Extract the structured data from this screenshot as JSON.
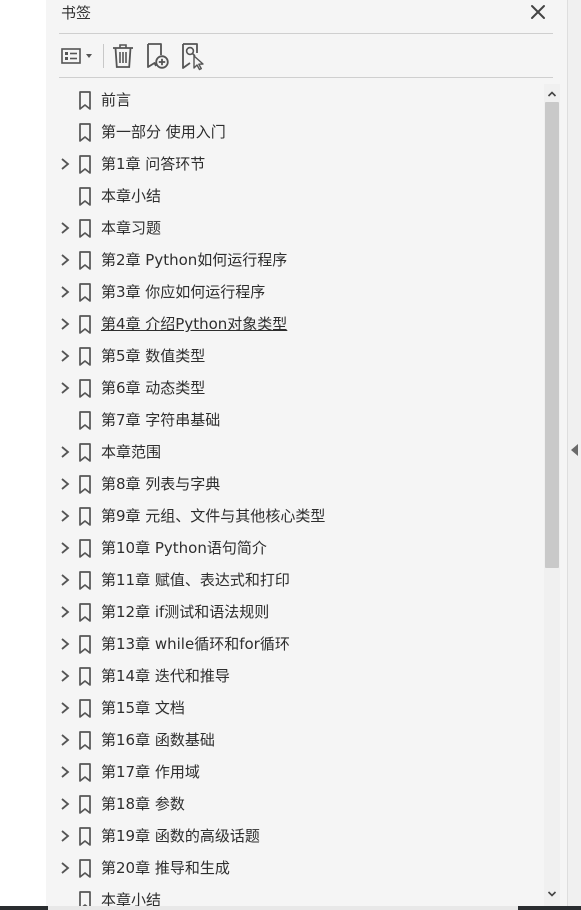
{
  "panel": {
    "title": "书签",
    "close_icon": "close-icon",
    "toolbar": [
      {
        "name": "options-menu-button",
        "icon": "list-options-icon"
      },
      {
        "name": "delete-bookmark-button",
        "icon": "trash-icon"
      },
      {
        "name": "new-bookmark-button",
        "icon": "bookmark-add-icon"
      },
      {
        "name": "find-current-bookmark-button",
        "icon": "bookmark-find-icon"
      }
    ]
  },
  "bookmarks": [
    {
      "label": "前言",
      "expandable": false
    },
    {
      "label": "第一部分  使用入门",
      "expandable": false
    },
    {
      "label": "第1章  问答环节",
      "expandable": true
    },
    {
      "label": "本章小结",
      "expandable": false
    },
    {
      "label": "本章习题",
      "expandable": true
    },
    {
      "label": "第2章  Python如何运行程序",
      "expandable": true
    },
    {
      "label": "第3章  你应如何运行程序",
      "expandable": true
    },
    {
      "label": "第4章  介绍Python对象类型",
      "expandable": true,
      "hover": true
    },
    {
      "label": "第5章  数值类型",
      "expandable": true
    },
    {
      "label": "第6章  动态类型",
      "expandable": true
    },
    {
      "label": "第7章  字符串基础",
      "expandable": false
    },
    {
      "label": "本章范围",
      "expandable": true
    },
    {
      "label": "第8章  列表与字典",
      "expandable": true
    },
    {
      "label": "第9章  元组、文件与其他核心类型",
      "expandable": true
    },
    {
      "label": "第10章  Python语句简介",
      "expandable": true
    },
    {
      "label": "第11章  赋值、表达式和打印",
      "expandable": true
    },
    {
      "label": "第12章  if测试和语法规则",
      "expandable": true
    },
    {
      "label": "第13章  while循环和for循环",
      "expandable": true
    },
    {
      "label": "第14章  迭代和推导",
      "expandable": true
    },
    {
      "label": "第15章  文档",
      "expandable": true
    },
    {
      "label": "第16章  函数基础",
      "expandable": true
    },
    {
      "label": "第17章  作用域",
      "expandable": true
    },
    {
      "label": "第18章  参数",
      "expandable": true
    },
    {
      "label": "第19章  函数的高级话题",
      "expandable": true
    },
    {
      "label": "第20章  推导和生成",
      "expandable": true
    },
    {
      "label": "本章小结",
      "expandable": false
    }
  ],
  "scrollbar": {
    "up_icon": "scroll-up-icon",
    "down_icon": "scroll-down-icon"
  },
  "colors": {
    "panel_bg": "#f5f5f5",
    "icon": "#555555",
    "text": "#2e2e2e",
    "scroll_thumb": "#c9c9c9"
  }
}
